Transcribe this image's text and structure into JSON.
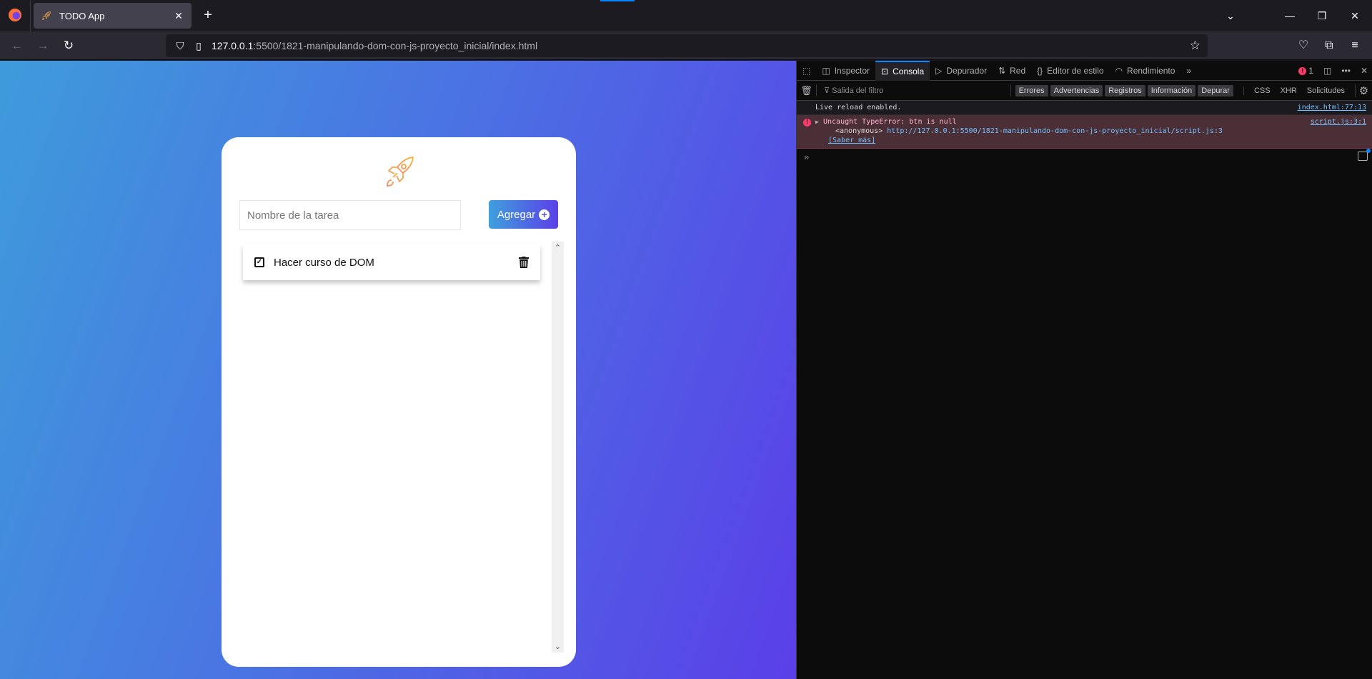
{
  "browser": {
    "tab": {
      "title": "TODO App",
      "close": "✕"
    },
    "new_tab": "+",
    "window_controls": {
      "list_all_tabs": "⌄",
      "minimize": "—",
      "restore": "❐",
      "close": "✕"
    },
    "url": {
      "host": "127.0.0.1",
      "rest": ":5500/1821-manipulando-dom-con-js-proyecto_inicial/index.html"
    },
    "nav": {
      "back": "←",
      "forward": "→",
      "reload": "↻",
      "bookmark": "☆",
      "pocket": "♡",
      "extensions": "⧉",
      "menu": "≡"
    }
  },
  "app": {
    "input": {
      "placeholder": "Nombre de la tarea",
      "value": ""
    },
    "add_button": {
      "label": "Agregar",
      "icon": "+"
    },
    "tasks": [
      {
        "text": "Hacer curso de DOM",
        "checked": true
      }
    ],
    "colors": {
      "gradient_start": "#3e9bdb",
      "gradient_end": "#5a3fe8",
      "rocket": "#f5a623"
    }
  },
  "devtools": {
    "tabs": [
      {
        "label": "Inspector",
        "icon": "◫"
      },
      {
        "label": "Consola",
        "icon": "⊡",
        "active": true
      },
      {
        "label": "Depurador",
        "icon": "▷"
      },
      {
        "label": "Red",
        "icon": "⇅"
      },
      {
        "label": "Editor de estilo",
        "icon": "{}"
      },
      {
        "label": "Rendimiento",
        "icon": "◠"
      }
    ],
    "more_tabs": "»",
    "error_count": "1",
    "filter_placeholder": "Salida del filtro",
    "level_filters": [
      "Errores",
      "Advertencias",
      "Registros",
      "Información",
      "Depurar"
    ],
    "type_filters": [
      "CSS",
      "XHR",
      "Solicitudes"
    ],
    "messages": [
      {
        "type": "log",
        "text": "Live reload enabled.",
        "source": "index.html:77:13"
      },
      {
        "type": "error",
        "text": "Uncaught TypeError: btn is null",
        "source": "script.js:3:1",
        "stack_fn": "<anonymous>",
        "stack_link": "http://127.0.0.1:5500/1821-manipulando-dom-con-js-proyecto_inicial/script.js:3",
        "learn_more": "[Saber más]"
      }
    ],
    "prompt": "»"
  }
}
